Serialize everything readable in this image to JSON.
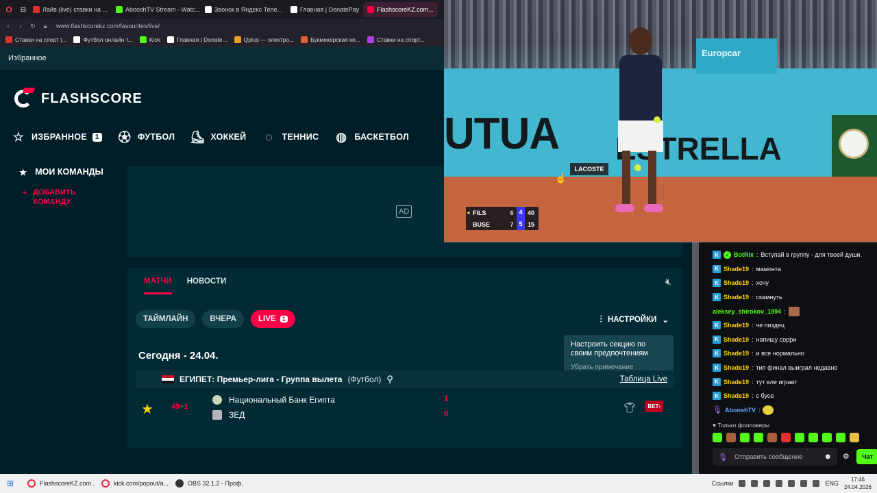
{
  "browser": {
    "tabs": [
      {
        "label": "Лайв (live) ставки на ...",
        "color": "#e23030"
      },
      {
        "label": "AbooshTV Stream - Watc...",
        "color": "#53fc18"
      },
      {
        "label": "Звонок в Яндекс Теле...",
        "color": "#ffffff"
      },
      {
        "label": "Главная | DonatePay",
        "color": "#ffffff"
      },
      {
        "label": "FlashscoreKZ.com...",
        "color": "#ff0046"
      }
    ],
    "url": "www.flashscorekz.com/favourites/live/",
    "bookmarks": [
      {
        "label": "Ставки на спорт |...",
        "color": "#e23030"
      },
      {
        "label": "Футбол онлайн т...",
        "color": "#ffffff"
      },
      {
        "label": "Kick",
        "color": "#53fc18"
      },
      {
        "label": "Главная | Donate...",
        "color": "#ffffff"
      },
      {
        "label": "Qplus — электро...",
        "color": "#f0a020"
      },
      {
        "label": "Букмекерская ко...",
        "color": "#e26030"
      },
      {
        "label": "Ставки на спорт...",
        "color": "#b040e0"
      }
    ]
  },
  "flashscore": {
    "favorites_strip": "Избранное",
    "logo_text": "FLASHSCORE",
    "sports": [
      {
        "label": "ИЗБРАННОЕ",
        "icon": "star-icon",
        "badge": "1"
      },
      {
        "label": "ФУТБОЛ",
        "icon": "football-icon"
      },
      {
        "label": "ХОККЕЙ",
        "icon": "hockey-icon"
      },
      {
        "label": "ТЕННИС",
        "icon": "tennis-icon"
      },
      {
        "label": "БАСКЕТБОЛ",
        "icon": "basketball-icon"
      }
    ],
    "sidebar": {
      "my_teams": "МОИ КОМАНДЫ",
      "add_team": "ДОБАВИТЬ КОМАНДУ"
    },
    "ad_label": "AD",
    "subtabs": [
      "МАТЧИ",
      "НОВОСТИ"
    ],
    "filters": {
      "timeline": "ТАЙМЛАЙН",
      "yesterday": "ВЧЕРА",
      "live": "LIVE",
      "live_count": "1"
    },
    "settings_label": "НАСТРОЙКИ",
    "tooltip": {
      "text": "Настроить секцию по своим предпочтениям",
      "dismiss": "Убрать примечание"
    },
    "date": "Сегодня - 24.04.",
    "league": {
      "name": "ЕГИПЕТ: Премьер-лига - Группа вылета",
      "sport": "(Футбол)",
      "table_link": "Таблица Live"
    },
    "match": {
      "time": "45+1",
      "home": "Национальный Банк Египта",
      "away": "ЗЕД",
      "home_score": "1",
      "away_score": "0",
      "bet_label": "BET"
    }
  },
  "stream": {
    "ad_text": "UTUA",
    "ad_text2": "ESTRELLA",
    "europcar": "Europcar",
    "lacoste": "LACOSTE",
    "scorebug": [
      {
        "name": "FILS",
        "serving": true,
        "set1": "6",
        "game": "4",
        "points": "40"
      },
      {
        "name": "BUSE",
        "serving": false,
        "set1": "7",
        "game": "5",
        "points": "15"
      }
    ]
  },
  "chat": {
    "messages": [
      {
        "user": "BotRix",
        "text": "Вступай в группу - для твоей души.",
        "style": "green",
        "verified": true
      },
      {
        "user": "Shade19",
        "text": "мамонта"
      },
      {
        "user": "Shade19",
        "text": "хочу"
      },
      {
        "user": "Shade19",
        "text": "скамнуть"
      },
      {
        "user": "aleksey_shirokov_1994",
        "text": "",
        "style": "green",
        "emoji": true
      },
      {
        "user": "Shade19",
        "text": "че пиздец"
      },
      {
        "user": "Shade19",
        "text": "напишу сорри"
      },
      {
        "user": "Shade19",
        "text": "и все нормально"
      },
      {
        "user": "Shade19",
        "text": "тип финал выиграл недавно"
      },
      {
        "user": "Shade19",
        "text": "тут еле играет"
      },
      {
        "user": "Shade19",
        "text": "с бусе"
      },
      {
        "user": "AbooshTV",
        "text": "",
        "style": "blue",
        "emoji": true
      }
    ],
    "followers_only": "Только фолловеры",
    "input_placeholder": "Отправить сообщение",
    "send_label": "Чат"
  },
  "taskbar": {
    "tasks": [
      "FlashscoreKZ.com ...",
      "kick.com/popout/a...",
      "OBS 32.1.2 - Проф..."
    ],
    "links_label": "Ссылки",
    "lang": "ENG",
    "time": "17:46",
    "date": "24.04.2026"
  }
}
